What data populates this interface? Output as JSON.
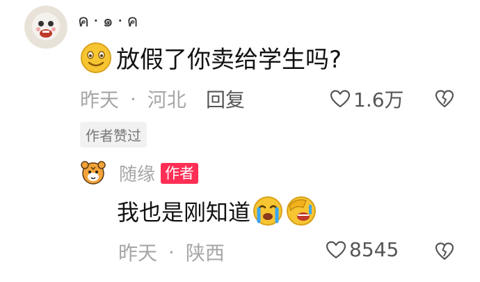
{
  "main_comment": {
    "username": "ค·๑·ค",
    "text": "放假了你卖给学生吗?",
    "emoji_icon": "smiling-face-icon",
    "time": "昨天",
    "location": "河北",
    "separator": "·",
    "reply_label": "回复",
    "like_count": "1.6万",
    "author_liked_badge": "作者赞过"
  },
  "reply_comment": {
    "username": "随缘",
    "author_badge": "作者",
    "text": "我也是刚知道",
    "emoji_icons": [
      "crying-face-icon",
      "face-palm-icon"
    ],
    "time": "昨天",
    "location": "陕西",
    "separator": "·",
    "like_count": "8545"
  },
  "colors": {
    "meta_gray": "#a6a6a6",
    "author_badge_bg": "#ff2e55",
    "text_dark": "#111111"
  }
}
